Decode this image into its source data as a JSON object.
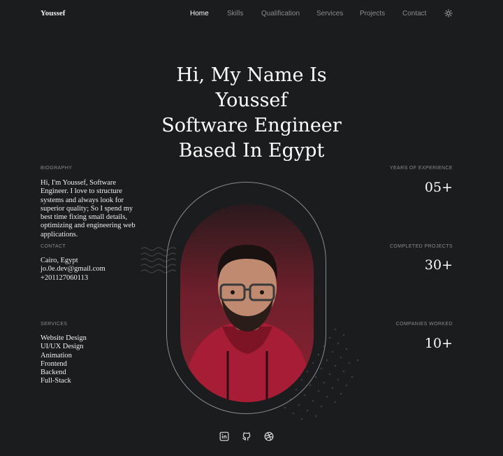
{
  "nav": {
    "brand": "Youssef",
    "items": [
      {
        "label": "Home",
        "active": true
      },
      {
        "label": "Skills",
        "active": false
      },
      {
        "label": "Qualification",
        "active": false
      },
      {
        "label": "Services",
        "active": false
      },
      {
        "label": "Projects",
        "active": false
      },
      {
        "label": "Contact",
        "active": false
      }
    ],
    "theme_toggle_icon": "sun-icon"
  },
  "hero": {
    "title_lines": [
      "Hi, My Name Is",
      "Youssef",
      "Software Engineer",
      "Based In Egypt"
    ]
  },
  "biography": {
    "label": "BIOGRAPHY",
    "lines": [
      "Hi, I'm Youssef, Software",
      "Engineer. I love to structure",
      "systems and always look for",
      "superior quality; So I spend my",
      "best time fixing small details,",
      "optimizing and engineering web",
      "applications."
    ]
  },
  "contact": {
    "label": "CONTACT",
    "location": "Cairo, Egypt",
    "email": "jo.0e.dev@gmail.com",
    "phone": "+201127060113"
  },
  "services": {
    "label": "SERVICES",
    "items": [
      "Website Design",
      "UI/UX Design",
      "Animation",
      "Frontend",
      "Backend",
      "Full-Stack"
    ]
  },
  "stats": [
    {
      "label": "YEARS OF EXPERIENCE",
      "value": "05+"
    },
    {
      "label": "COMPLETED PROJECTS",
      "value": "30+"
    },
    {
      "label": "COMPANIES WORKED",
      "value": "10+"
    }
  ],
  "social": [
    "linkedin-icon",
    "github-icon",
    "dribbble-icon"
  ],
  "colors": {
    "background": "#1b1c1e",
    "portrait_bg": "#8c2233",
    "nav_active": "#ffffff",
    "nav_inactive": "#8c8c8c"
  }
}
